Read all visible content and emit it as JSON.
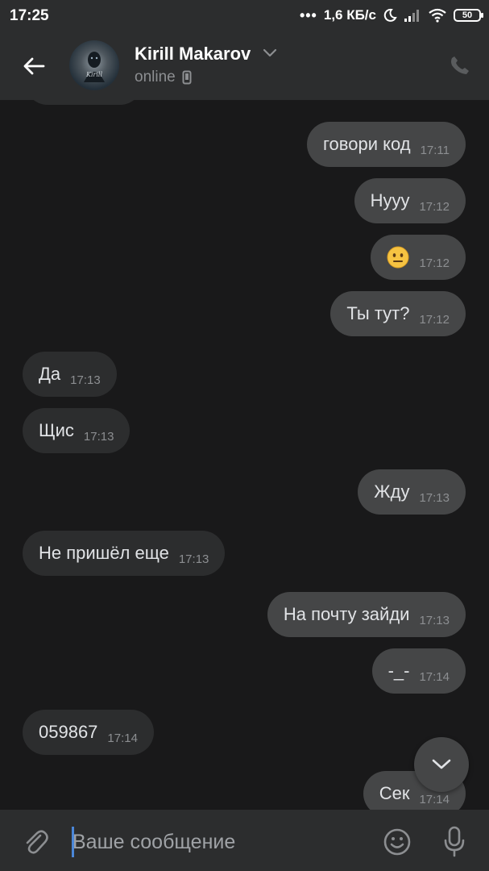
{
  "status_bar": {
    "time": "17:25",
    "dots": "•••",
    "speed": "1,6 КБ/с",
    "battery": "50"
  },
  "header": {
    "contact_name": "Kirill Makarov",
    "status": "online",
    "avatar_signature": "Kirill"
  },
  "messages": [
    {
      "dir": "in",
      "text": "",
      "time": ""
    },
    {
      "dir": "out",
      "text": "говори код",
      "time": "17:11"
    },
    {
      "dir": "out",
      "text": "Нууу",
      "time": "17:12"
    },
    {
      "dir": "out",
      "emoji": "neutral-face",
      "time": "17:12"
    },
    {
      "dir": "out",
      "text": "Ты тут?",
      "time": "17:12"
    },
    {
      "dir": "in",
      "text": "Да",
      "time": "17:13"
    },
    {
      "dir": "in",
      "text": "Щис",
      "time": "17:13"
    },
    {
      "dir": "out",
      "text": "Жду",
      "time": "17:13"
    },
    {
      "dir": "in",
      "text": "Не пришёл еще",
      "time": "17:13"
    },
    {
      "dir": "out",
      "text": "На почту зайди",
      "time": "17:13"
    },
    {
      "dir": "out",
      "text": "-_-",
      "time": "17:14"
    },
    {
      "dir": "in",
      "text": "059867",
      "time": "17:14"
    },
    {
      "dir": "out",
      "text": "Сек",
      "time": "17:14"
    }
  ],
  "composer": {
    "placeholder": "Ваше сообщение"
  },
  "colors": {
    "background": "#19191a",
    "header": "#2c2d2e",
    "incoming_bubble": "#2c2d2e",
    "outgoing_bubble": "#454647",
    "text": "#e1e3e6",
    "muted": "#8c8e91",
    "caret": "#4a86d8"
  }
}
